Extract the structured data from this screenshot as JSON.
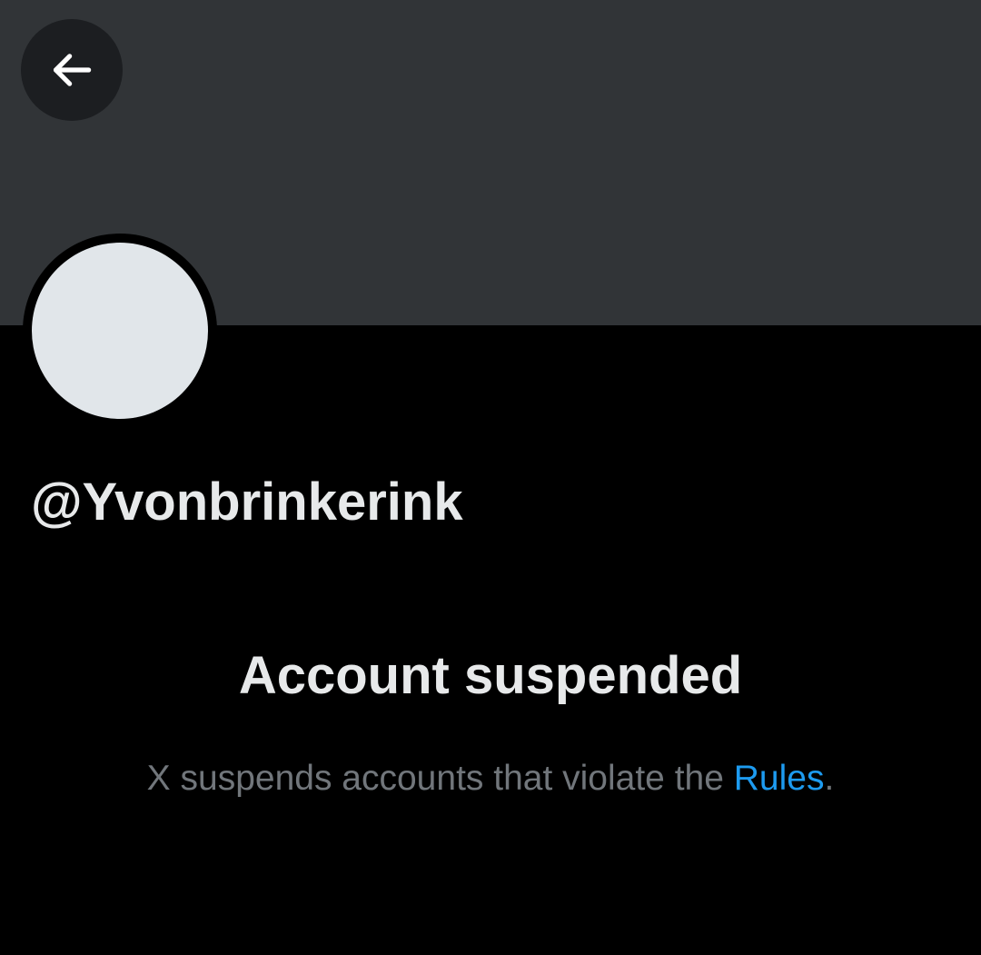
{
  "profile": {
    "handle": "@Yvonbrinkerink"
  },
  "header": {
    "back_icon": "arrow-left-icon"
  },
  "suspension": {
    "title": "Account suspended",
    "message_prefix": "X suspends accounts that violate the ",
    "rules_link_text": "Rules",
    "message_suffix": "."
  },
  "colors": {
    "background": "#000000",
    "banner": "#313437",
    "avatar_placeholder": "#e1e6ea",
    "primary_text": "#e7e9ea",
    "secondary_text": "#71767b",
    "link": "#1d9bf0"
  }
}
